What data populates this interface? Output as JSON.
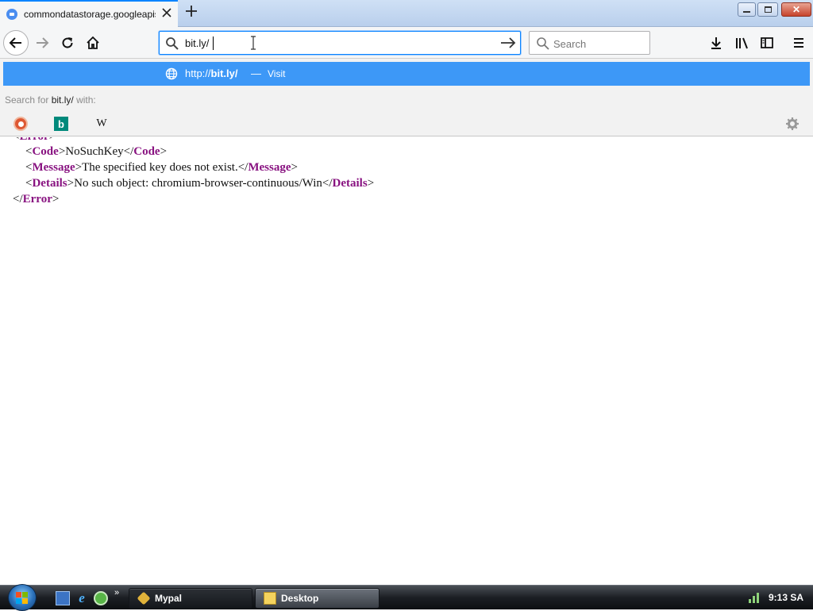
{
  "browser": {
    "tab": {
      "title": "commondatastorage.googleapis.com"
    },
    "window_controls": {
      "close_glyph": "✕"
    }
  },
  "urlbar": {
    "value": "bit.ly/"
  },
  "searchbar": {
    "placeholder": "Search"
  },
  "popup": {
    "suggestion": {
      "prefix": "http://",
      "bold": "bit.ly/",
      "separator": "—",
      "action": "Visit"
    },
    "search_for": {
      "label": "Search for",
      "query": "bit.ly/",
      "suffix": "with:"
    },
    "engines": {
      "bing_glyph": "b",
      "wiki_glyph": "W"
    }
  },
  "document": {
    "open_tag": "Error",
    "code_tag": "Code",
    "code_value": "NoSuchKey",
    "message_tag": "Message",
    "message_value": "The specified key does not exist.",
    "details_tag": "Details",
    "details_value": "No such object: chromium-browser-continuous/Win"
  },
  "taskbar": {
    "quicklaunch_more": "»",
    "tasks": [
      {
        "label": "Mypal"
      },
      {
        "label": "Desktop"
      }
    ],
    "clock": "9:13 SA"
  },
  "colors": {
    "accent": "#0a84ff",
    "suggestion_highlight": "#3d98f7",
    "xml_tag": "#881280"
  },
  "icons": [
    "tab-favicon-icon",
    "close-icon",
    "plus-icon",
    "back-arrow-icon",
    "forward-arrow-icon",
    "reload-icon",
    "home-icon",
    "search-icon",
    "go-arrow-icon",
    "download-icon",
    "library-icon",
    "sidebar-icon",
    "hamburger-menu-icon",
    "globe-icon",
    "duckduckgo-icon",
    "bing-icon",
    "wikipedia-icon",
    "gear-icon",
    "windows-start-icon",
    "network-icon"
  ]
}
